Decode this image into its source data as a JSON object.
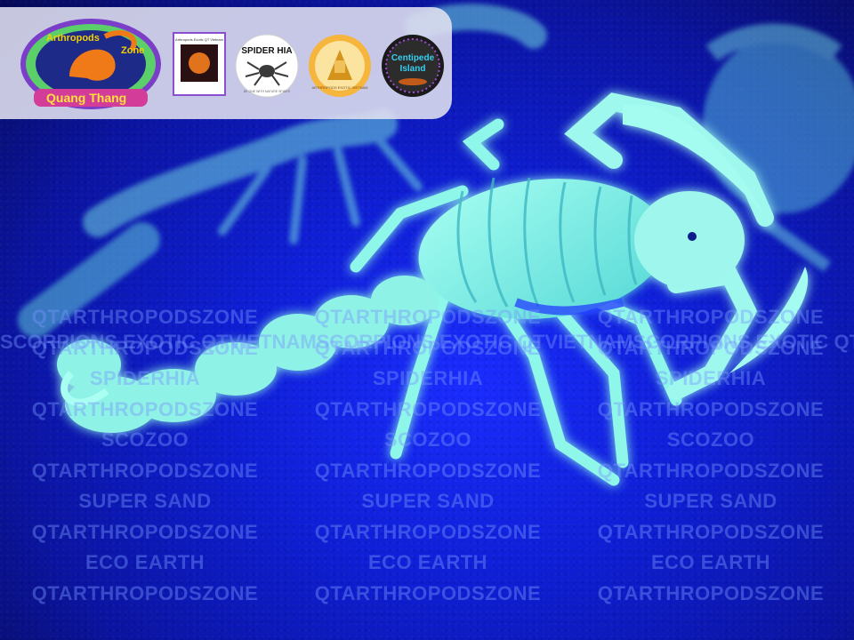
{
  "logos": {
    "main": {
      "line1": "Arthropods",
      "line2": "Zone",
      "line3": "Quang Thang"
    },
    "small_card": {
      "caption": "Arthropods Exotic QT Vietnam"
    },
    "spider_hia": {
      "title": "SPIDER HIA",
      "ring": "BE ONE WITH NATURE SPIDER"
    },
    "sphinx": {
      "caption": "ARTHROPODS EXOTIC VIETNAM"
    },
    "centipede": {
      "title": "Centipede",
      "title2": "Island"
    }
  },
  "watermark": {
    "band": "SCORPIONS EXOTIC QTVIETNAMSCORPIONS EXOTIC QTVIETNAMSCORPIONS EXOTIC QTVIETNAM",
    "left": [
      "QTARTHROPODSZONE",
      "",
      "QTARTHROPODSZONE",
      "SPIDERHIA",
      "QTARTHROPODSZONE",
      "SCOZOO",
      "QTARTHROPODSZONE",
      "SUPER SAND",
      "QTARTHROPODSZONE",
      "ECO EARTH",
      "QTARTHROPODSZONE"
    ],
    "middle": [
      "QTARTHROPODSZONE",
      "",
      "QTARTHROPODSZONE",
      "SPIDERHIA",
      "QTARTHROPODSZONE",
      "SCOZOO",
      "QTARTHROPODSZONE",
      "SUPER SAND",
      "QTARTHROPODSZONE",
      "ECO EARTH",
      "QTARTHROPODSZONE"
    ],
    "right": [
      "QTARTHROPODSZONE",
      "",
      "QTARTHROPODSZONE",
      "SPIDERHIA",
      "QTARTHROPODSZONE",
      "SCOZOO",
      "QTARTHROPODSZONE",
      "SUPER SAND",
      "QTARTHROPODSZONE",
      "ECO EARTH",
      "QTARTHROPODSZONE"
    ]
  },
  "colors": {
    "uv_background": "#1020d8",
    "scorpion_glow": "#7ff5e6",
    "logo_orange": "#f07a18"
  }
}
